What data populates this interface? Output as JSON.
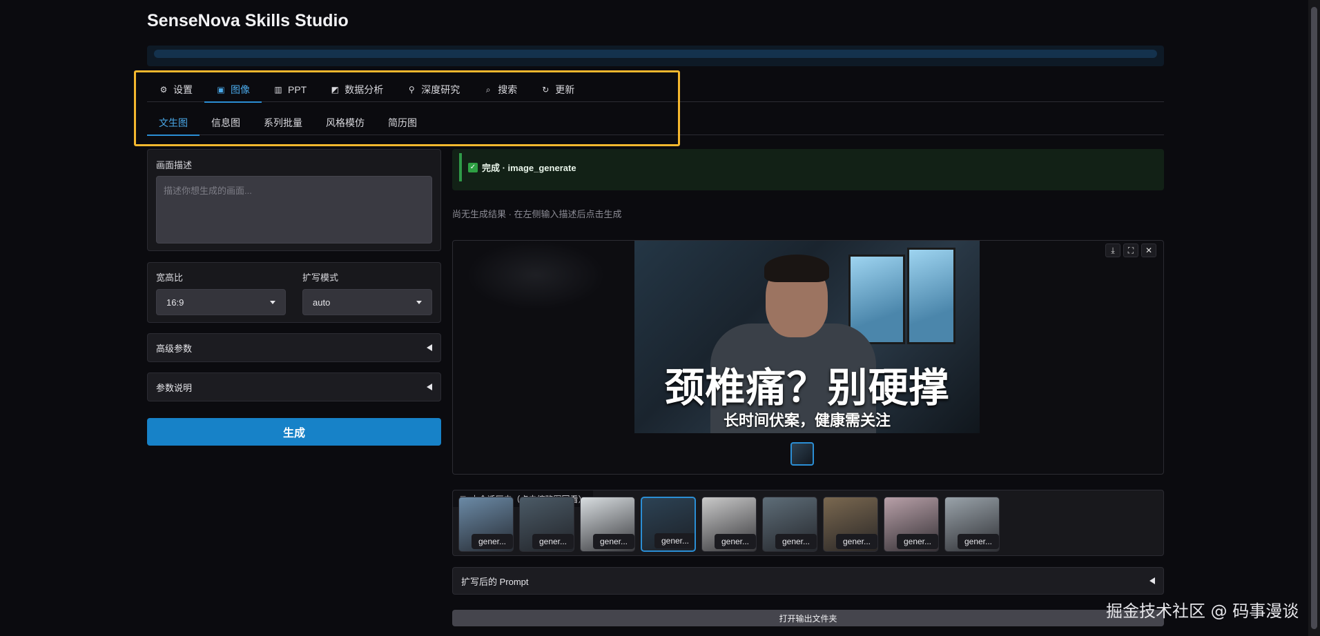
{
  "app": {
    "title": "SenseNova Skills Studio"
  },
  "progress": {
    "value": 1.0
  },
  "main_tabs": [
    {
      "icon": "gear-icon",
      "glyph": "⚙",
      "label": "设置",
      "active": false
    },
    {
      "icon": "image-icon",
      "glyph": "▣",
      "label": "图像",
      "active": true
    },
    {
      "icon": "bar-chart-icon",
      "glyph": "▥",
      "label": "PPT",
      "active": false
    },
    {
      "icon": "line-chart-icon",
      "glyph": "◩",
      "label": "数据分析",
      "active": false
    },
    {
      "icon": "microscope-icon",
      "glyph": "⚲",
      "label": "深度研究",
      "active": false
    },
    {
      "icon": "search-icon",
      "glyph": "⌕",
      "label": "搜索",
      "active": false
    },
    {
      "icon": "refresh-icon",
      "glyph": "↻",
      "label": "更新",
      "active": false
    }
  ],
  "sub_tabs": [
    {
      "label": "文生图",
      "active": true
    },
    {
      "label": "信息图",
      "active": false
    },
    {
      "label": "系列批量",
      "active": false
    },
    {
      "label": "风格模仿",
      "active": false
    },
    {
      "label": "简历图",
      "active": false
    }
  ],
  "left": {
    "desc_label": "画面描述",
    "desc_placeholder": "描述你想生成的画面...",
    "aspect_label": "宽高比",
    "aspect_value": "16:9",
    "expand_label": "扩写模式",
    "expand_value": "auto",
    "advanced_label": "高级参数",
    "help_label": "参数说明",
    "generate_label": "生成"
  },
  "status": {
    "text": "完成 · image_generate",
    "color": "#2ea043"
  },
  "hint": "尚无生成结果 · 在左侧输入描述后点击生成",
  "image": {
    "title": "颈椎痛？别硬撑",
    "subtitle": "长时间伏案，健康需关注"
  },
  "viewer_tools": [
    {
      "icon": "download-icon",
      "glyph": "⤓"
    },
    {
      "icon": "fullscreen-icon",
      "glyph": "⛶"
    },
    {
      "icon": "close-icon",
      "glyph": "✕"
    }
  ],
  "gallery": {
    "label": "本会话历史（点击缩略图回看）",
    "items": [
      {
        "caption": "gener...",
        "bg": "#6b8aa6",
        "selected": false
      },
      {
        "caption": "gener...",
        "bg": "#4b5a66",
        "selected": false
      },
      {
        "caption": "gener...",
        "bg": "#d8dde0",
        "selected": false
      },
      {
        "caption": "gener...",
        "bg": "#2c4254",
        "selected": true
      },
      {
        "caption": "gener...",
        "bg": "#c9c9c9",
        "selected": false
      },
      {
        "caption": "gener...",
        "bg": "#5e6d78",
        "selected": false
      },
      {
        "caption": "gener...",
        "bg": "#7a6850",
        "selected": false
      },
      {
        "caption": "gener...",
        "bg": "#b8a0a8",
        "selected": false
      },
      {
        "caption": "gener...",
        "bg": "#9aa3aa",
        "selected": false
      }
    ]
  },
  "prompt_label": "扩写后的 Prompt",
  "open_folder_label": "打开输出文件夹",
  "watermark": "掘金技术社区 @ 码事漫谈",
  "colors": {
    "accent": "#2b8fd6",
    "highlight": "#f5b82e",
    "button": "#1782c8"
  }
}
